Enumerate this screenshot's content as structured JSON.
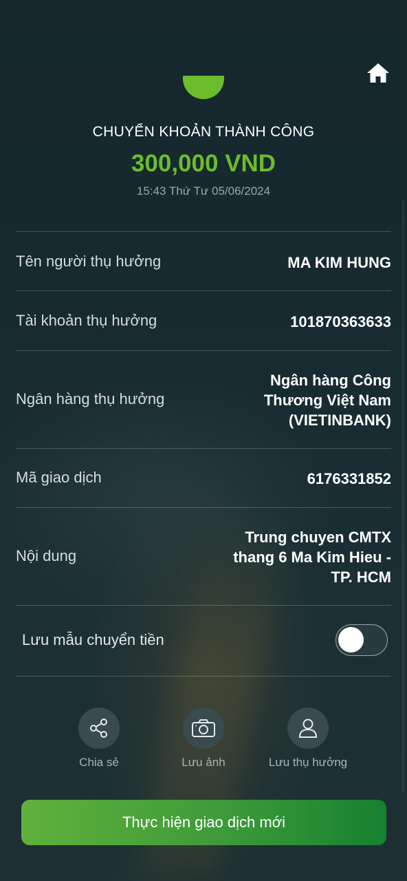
{
  "header": {
    "home_icon": "home-icon",
    "status_title": "CHUYỂN KHOẢN THÀNH CÔNG",
    "amount": "300,000 VND",
    "datetime": "15:43 Thứ Tư 05/06/2024",
    "accent_color": "#6cbc2c"
  },
  "details": [
    {
      "label": "Tên người thụ hưởng",
      "value_lines": [
        "MA KIM HUNG"
      ]
    },
    {
      "label": "Tài khoản thụ hưởng",
      "value_lines": [
        "101870363633"
      ]
    },
    {
      "label": "Ngân hàng thụ hưởng",
      "value_lines": [
        "Ngân hàng  Công",
        "Thương Việt Nam",
        "(VIETINBANK)"
      ]
    },
    {
      "label": "Mã giao dịch",
      "value_lines": [
        "6176331852"
      ]
    },
    {
      "label": "Nội dung",
      "value_lines": [
        "Trung chuyen CMTX",
        "thang 6 Ma Kim Hieu -",
        "TP. HCM"
      ]
    }
  ],
  "save_template": {
    "label": "Lưu mẫu chuyển tiền",
    "enabled": false
  },
  "actions": [
    {
      "icon": "share-icon",
      "label": "Chia sẻ"
    },
    {
      "icon": "camera-icon",
      "label": "Lưu ảnh"
    },
    {
      "icon": "user-icon",
      "label": "Lưu thụ hưởng"
    }
  ],
  "primary_button": {
    "label": "Thực hiện giao dịch mới"
  }
}
